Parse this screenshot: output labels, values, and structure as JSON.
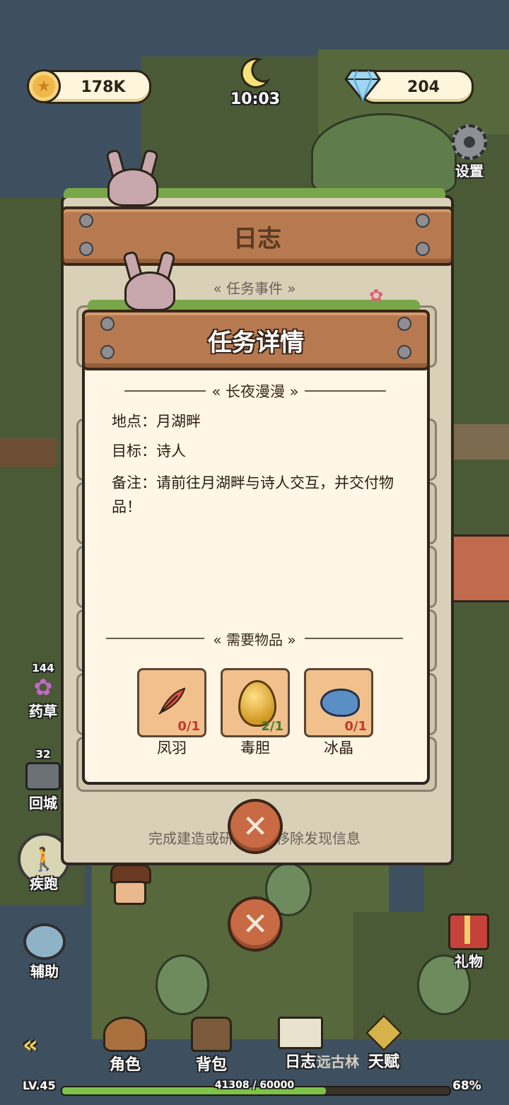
{
  "hud": {
    "coins": "178K",
    "time": "10:03",
    "gems": "204",
    "settings_label": "设置"
  },
  "side_left": {
    "herb_count": "144",
    "herb_label": "药草",
    "return_count": "32",
    "return_label": "回城",
    "run_label": "疾跑",
    "assist_label": "辅助"
  },
  "side_right": {
    "gift_label": "礼物"
  },
  "journal": {
    "title": "日志",
    "section": "任务事件",
    "footer_hint": "完成建造或研究后可移除发现信息"
  },
  "quest": {
    "title": "任务详情",
    "name": "长夜漫漫",
    "location_line": "地点：月湖畔",
    "target_line": "目标：诗人",
    "note_line": "备注：请前往月湖畔与诗人交互，并交付物品！",
    "required_header": "需要物品",
    "items": [
      {
        "name": "凤羽",
        "count": "0/1",
        "icon": "feather-icon",
        "count_color": "#c0392b"
      },
      {
        "name": "毒胆",
        "count": "2/1",
        "icon": "gold-egg-icon",
        "count_color": "#3f7d2c"
      },
      {
        "name": "冰晶",
        "count": "0/1",
        "icon": "blue-stone-icon",
        "count_color": "#c0392b"
      }
    ]
  },
  "bottom_menu": {
    "character": "角色",
    "backpack": "背包",
    "journal": "日志",
    "talent": "天赋",
    "overlap_text": "远古林"
  },
  "level": {
    "label": "LV.45",
    "progress_text": "41308 / 60000",
    "percent": "68%",
    "fraction": 0.68
  }
}
